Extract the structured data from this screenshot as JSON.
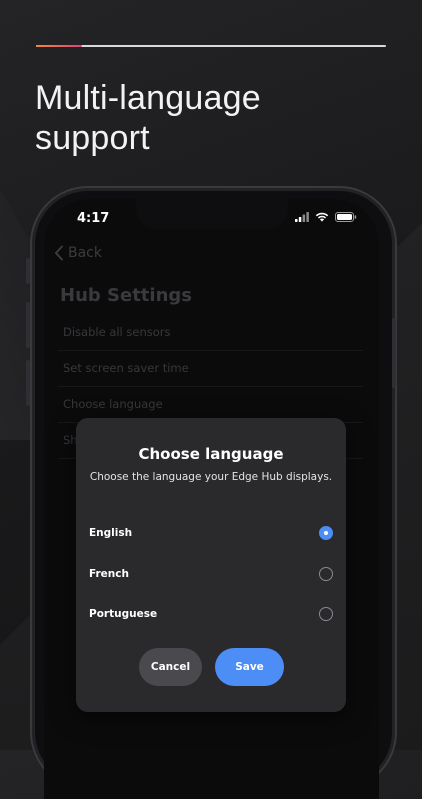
{
  "promo": {
    "headline_line1": "Multi-language",
    "headline_line2": "support",
    "progress": 0.13
  },
  "status_bar": {
    "time": "4:17"
  },
  "nav": {
    "back_label": "Back"
  },
  "hub_settings": {
    "title": "Hub Settings",
    "items": [
      {
        "label": "Disable all sensors"
      },
      {
        "label": "Set screen saver time"
      },
      {
        "label": "Choose language"
      },
      {
        "label": "Sh"
      }
    ]
  },
  "dialog": {
    "title": "Choose language",
    "subtitle": "Choose the language your Edge Hub displays.",
    "options": [
      {
        "label": "English",
        "selected": true
      },
      {
        "label": "French",
        "selected": false
      },
      {
        "label": "Portuguese",
        "selected": false
      }
    ],
    "cancel_label": "Cancel",
    "save_label": "Save"
  },
  "colors": {
    "accent": "#4d8df6",
    "progress_start": "#f08a3c",
    "progress_end": "#e0407a"
  }
}
